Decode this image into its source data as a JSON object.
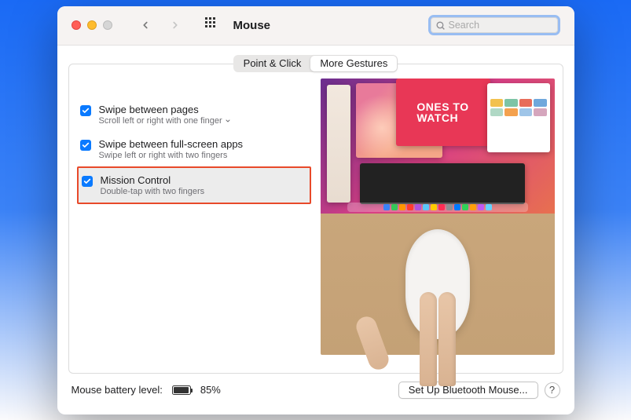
{
  "titlebar": {
    "title": "Mouse",
    "search_placeholder": "Search"
  },
  "tabs": {
    "point_click": "Point & Click",
    "more_gestures": "More Gestures"
  },
  "options": {
    "swipe_pages": {
      "label": "Swipe between pages",
      "sub": "Scroll left or right with one finger"
    },
    "swipe_apps": {
      "label": "Swipe between full-screen apps",
      "sub": "Swipe left or right with two fingers"
    },
    "mission_control": {
      "label": "Mission Control",
      "sub": "Double-tap with two fingers"
    }
  },
  "preview": {
    "ones_to_watch": "ONES TO\nWATCH"
  },
  "footer": {
    "battery_label": "Mouse battery level:",
    "battery_pct": "85%",
    "bluetooth_btn": "Set Up Bluetooth Mouse...",
    "help": "?"
  }
}
